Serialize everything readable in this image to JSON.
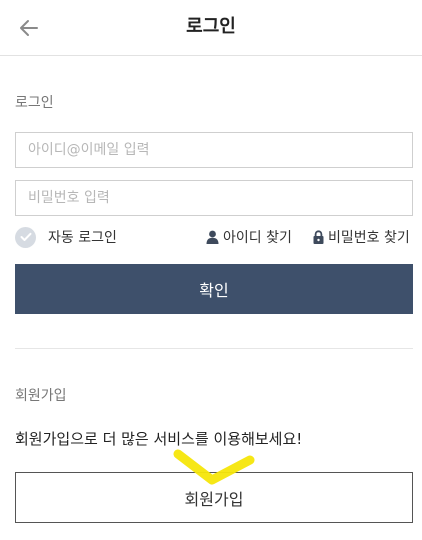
{
  "header": {
    "title": "로그인",
    "back_icon": "arrow-left-icon"
  },
  "login": {
    "section_label": "로그인",
    "id_placeholder": "아이디@이메일 입력",
    "id_value": "",
    "password_placeholder": "비밀번호 입력",
    "password_value": "",
    "auto_login_label": "자동 로그인",
    "auto_login_checked": false,
    "find_id_label": "아이디 찾기",
    "find_password_label": "비밀번호 찾기",
    "confirm_label": "확인"
  },
  "signup": {
    "section_label": "회원가입",
    "promo_text": "회원가입으로 더 많은 서비스를 이용해보세요!",
    "button_label": "회원가입"
  },
  "colors": {
    "primary_button": "#3e506b",
    "highlight_mark": "#f5e60a"
  }
}
